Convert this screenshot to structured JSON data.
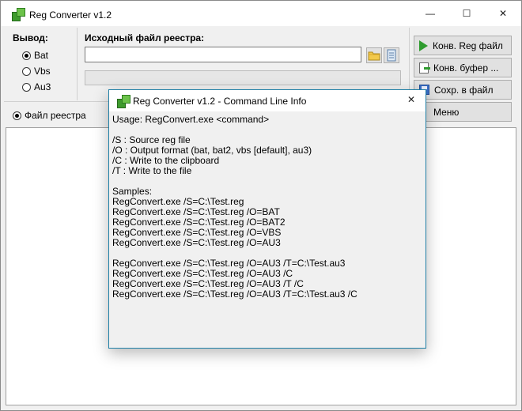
{
  "main_window": {
    "title": "Reg Converter v1.2",
    "minimize_glyph": "—",
    "maximize_glyph": "☐",
    "close_glyph": "✕"
  },
  "output": {
    "label": "Вывод:",
    "options": [
      "Bat",
      "Vbs",
      "Au3"
    ],
    "selected": "Bat"
  },
  "source": {
    "label": "Исходный файл реестра:",
    "value": "",
    "progress": 0
  },
  "buttons": {
    "convert_reg": "Конв. Reg файл",
    "convert_clipboard": "Конв. буфер ...",
    "save_file": "Сохр. в файл",
    "menu": "Меню"
  },
  "mode": {
    "option": "Файл реестра",
    "selected": true
  },
  "dialog": {
    "title": "Reg Converter v1.2 - Command Line Info",
    "close_glyph": "✕",
    "lines": [
      "Usage: RegConvert.exe <command>",
      "",
      "/S : Source reg file",
      "/O : Output format (bat, bat2, vbs [default], au3)",
      "/C : Write to the clipboard",
      "/T : Write to the file",
      "",
      "Samples:",
      "RegConvert.exe /S=C:\\Test.reg",
      "RegConvert.exe /S=C:\\Test.reg /O=BAT",
      "RegConvert.exe /S=C:\\Test.reg /O=BAT2",
      "RegConvert.exe /S=C:\\Test.reg /O=VBS",
      "RegConvert.exe /S=C:\\Test.reg /O=AU3",
      "",
      "RegConvert.exe /S=C:\\Test.reg /O=AU3 /T=C:\\Test.au3",
      "RegConvert.exe /S=C:\\Test.reg /O=AU3 /C",
      "RegConvert.exe /S=C:\\Test.reg /O=AU3 /T /C",
      "RegConvert.exe /S=C:\\Test.reg /O=AU3 /T=C:\\Test.au3 /C"
    ]
  },
  "icons": {
    "app": "app-icon",
    "browse": "folder-icon",
    "clipboard": "notepad-icon",
    "convert": "play-icon",
    "convert_clipboard": "clipboard-icon",
    "save": "disk-icon",
    "menu": "menu-icon"
  },
  "colors": {
    "accent": "#2e9b2e",
    "dialog_border": "#1f7fa6",
    "window_bg": "#f0f0f0"
  }
}
